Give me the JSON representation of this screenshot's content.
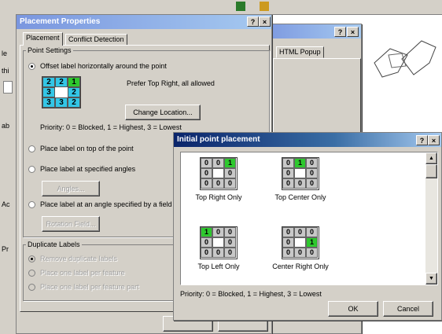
{
  "placement_dialog": {
    "title": "Placement Properties",
    "help_btn": "?",
    "close_btn": "×",
    "tabs": [
      "Placement",
      "Conflict Detection"
    ],
    "point_settings": {
      "group_label": "Point Settings",
      "offset_label": "Offset label horizontally around the point",
      "prefer_text": "Prefer Top Right, all allowed",
      "grid": [
        "2",
        "2",
        "1",
        "3",
        "",
        "2",
        "3",
        "3",
        "2"
      ],
      "change_location": "Change Location...",
      "priority": "Priority:  0 = Blocked, 1 = Highest, 3 = Lowest",
      "on_top": "Place label on top of the point",
      "at_angles": "Place label at specified angles",
      "angles_btn": "Angles...",
      "angle_field": "Place label at an angle specified by a field",
      "rotation_btn": "Rotation Field..."
    },
    "duplicate_labels": {
      "group_label": "Duplicate Labels",
      "remove": "Remove duplicate labels",
      "one_per_feature": "Place one label per feature",
      "one_per_part": "Place one label per feature part"
    }
  },
  "background_dialog": {
    "help_btn": "?",
    "close_btn": "×",
    "html_popup_tab": "HTML Popup"
  },
  "side_fragments": [
    "le",
    "thi",
    "I",
    "ab",
    "Ac",
    "Pr"
  ],
  "initial_dialog": {
    "title": "Initial point placement",
    "help_btn": "?",
    "close_btn": "×",
    "previews": [
      {
        "label": "Top Right Only",
        "cells": [
          "0",
          "0",
          "1",
          "0",
          "",
          "0",
          "0",
          "0",
          "0"
        ],
        "highlight": 2
      },
      {
        "label": "Top Center Only",
        "cells": [
          "0",
          "1",
          "0",
          "0",
          "",
          "0",
          "0",
          "0",
          "0"
        ],
        "highlight": 1
      },
      {
        "label": "Top Left Only",
        "cells": [
          "1",
          "0",
          "0",
          "0",
          "",
          "0",
          "0",
          "0",
          "0"
        ],
        "highlight": 0
      },
      {
        "label": "Center Right Only",
        "cells": [
          "0",
          "0",
          "0",
          "0",
          "",
          "1",
          "0",
          "0",
          "0"
        ],
        "highlight": 5
      }
    ],
    "priority": "Priority:  0 = Blocked, 1 = Highest, 3 = Lowest",
    "ok": "OK",
    "cancel": "Cancel"
  }
}
